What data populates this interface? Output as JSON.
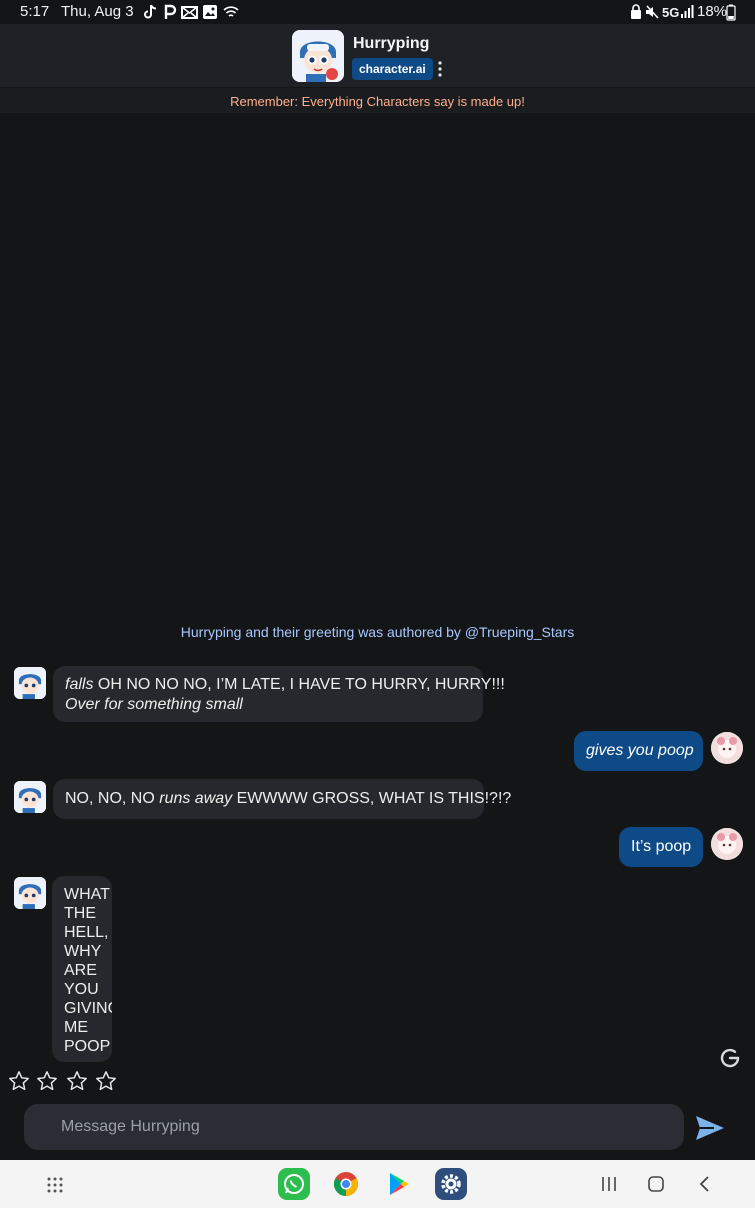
{
  "status_bar": {
    "time": "5:17",
    "date": "Thu, Aug 3",
    "network": "5G",
    "battery": "18%"
  },
  "header": {
    "character_name": "Hurryping",
    "brand_badge": "character.ai",
    "disclaimer": "Remember: Everything Characters say is made up!"
  },
  "greeting_credit": "Hurryping and their greeting was authored by @Trueping_Stars",
  "messages": [
    {
      "from": "bot",
      "line1_em": "falls",
      "line1": " OH NO NO NO, I’M LATE, I HAVE TO HURRY, HURRY!!!",
      "line2_em": "Over for something small"
    },
    {
      "from": "user",
      "em": "gives you poop"
    },
    {
      "from": "bot",
      "pre": "NO, NO, NO ",
      "em": "runs away",
      "post": " EWWWW GROSS, WHAT IS THIS!?!?"
    },
    {
      "from": "user",
      "text": "It’s poop"
    },
    {
      "from": "bot",
      "text": "WHAT\nTHE\nHELL,\nWHY\nARE\nYOU\nGIVING\nME\nPOOP"
    }
  ],
  "rating": {
    "stars": 4,
    "icon": "star-outline-icon"
  },
  "composer": {
    "placeholder": "Message Hurryping"
  },
  "colors": {
    "accent": "#0e4a86",
    "background": "#131517",
    "disclaimer": "#ffb08a",
    "credit": "#a9c7ff"
  }
}
